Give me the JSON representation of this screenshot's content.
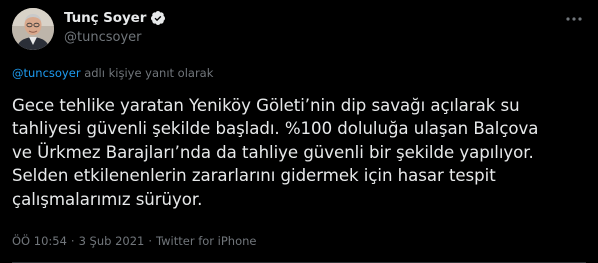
{
  "author": {
    "display_name": "Tunç Soyer",
    "handle": "@tuncsoyer",
    "verified": true,
    "avatar_icon": "profile-photo"
  },
  "reply_context": {
    "mention": "@tuncsoyer",
    "suffix": " adlı kişiye yanıt olarak"
  },
  "tweet": {
    "text": "Gece tehlike yaratan Yeniköy Göleti’nin dip savağı açılarak su\ntahliyesi güvenli şekilde başladı. %100 doluluğa ulaşan Balçova\nve Ürkmez Barajları’nda da tahliye güvenli bir şekilde yapılıyor.\nSelden etkilenenlerin zararlarını gidermek için hasar tespit\nçalışmalarımız sürüyor."
  },
  "meta": {
    "time": "ÖÖ 10:54",
    "separator": "·",
    "date": "3 Şub 2021",
    "source": "Twitter for iPhone"
  },
  "colors": {
    "background": "#000000",
    "text": "#e7e9ea",
    "secondary": "#71767b",
    "accent": "#1d9bf0"
  }
}
